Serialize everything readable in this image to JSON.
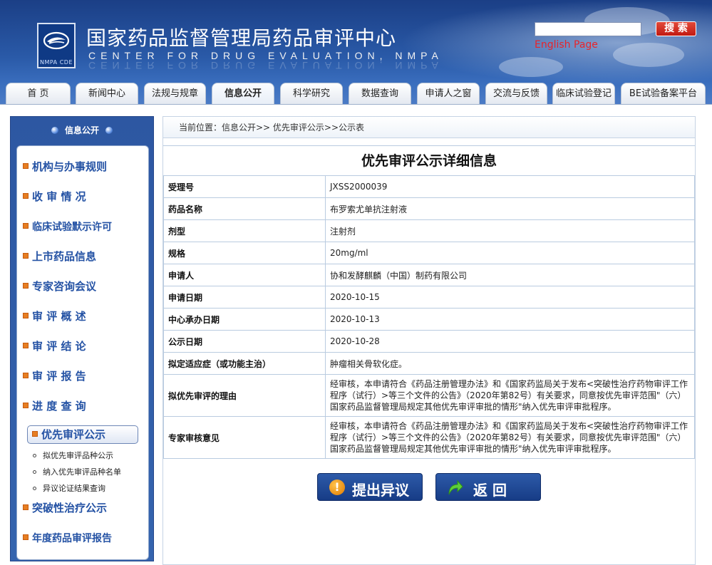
{
  "header": {
    "title": "国家药品监督管理局药品审评中心",
    "subtitle": "CENTER FOR DRUG EVALUATION, NMPA",
    "logo_text": "NMPA CDE",
    "search_placeholder": "",
    "search_button": "搜 索",
    "english_link": "English Page"
  },
  "nav": {
    "tabs": [
      "首 页",
      "新闻中心",
      "法规与规章",
      "信息公开",
      "科学研究",
      "数据查询",
      "申请人之窗",
      "交流与反馈",
      "临床试验登记",
      "BE试验备案平台"
    ],
    "active": "信息公开"
  },
  "sidebar": {
    "title": "信息公开",
    "items": [
      "机构与办事规则",
      "收 审 情 况",
      "临床试验默示许可",
      "上市药品信息",
      "专家咨询会议",
      "审 评 概 述",
      "审 评 结 论",
      "审 评 报 告",
      "进 度 查 询",
      "优先审评公示"
    ],
    "subitems": [
      "拟优先审评品种公示",
      "纳入优先审评品种名单",
      "异议论证结果查询"
    ],
    "items_after": [
      "突破性治疗公示",
      "年度药品审评报告"
    ]
  },
  "content": {
    "breadcrumb": "当前位置：信息公开>> 优先审评公示>>公示表",
    "title": "优先审评公示详细信息",
    "rows": [
      {
        "label": "受理号",
        "value": "JXSS2000039"
      },
      {
        "label": "药品名称",
        "value": "布罗索尤单抗注射液"
      },
      {
        "label": "剂型",
        "value": "注射剂"
      },
      {
        "label": "规格",
        "value": "20mg/ml"
      },
      {
        "label": "申请人",
        "value": "协和发酵麒麟（中国）制药有限公司"
      },
      {
        "label": "申请日期",
        "value": "2020-10-15"
      },
      {
        "label": "中心承办日期",
        "value": "2020-10-13"
      },
      {
        "label": "公示日期",
        "value": "2020-10-28"
      },
      {
        "label": "拟定适应症（或功能主治）",
        "value": "肿瘤相关骨软化症。"
      },
      {
        "label": "拟优先审评的理由",
        "value": "经审核，本申请符合《药品注册管理办法》和《国家药监局关于发布<突破性治疗药物审评工作程序（试行）>等三个文件的公告》（2020年第82号）有关要求，同意按优先审评范围\"（六）国家药品监督管理局规定其他优先审评审批的情形\"纳入优先审评审批程序。"
      },
      {
        "label": "专家审核意见",
        "value": "经审核，本申请符合《药品注册管理办法》和《国家药监局关于发布<突破性治疗药物审评工作程序（试行）>等三个文件的公告》（2020年第82号）有关要求，同意按优先审评范围\"（六）国家药品监督管理局规定其他优先审评审批的情形\"纳入优先审评审批程序。"
      }
    ],
    "objection_button": "提出异议",
    "return_button": "返 回"
  },
  "colors": {
    "header_blue": "#2a5aa8",
    "search_red": "#c11a12",
    "english_red": "#e8242a",
    "sidebar_blue": "#3564ae",
    "link_blue": "#2452a4",
    "bullet_orange": "#e67e22",
    "button_blue": "#173c86"
  },
  "icons": {
    "logo": "nmpa-logo",
    "sidebar_bullet": "orange-square-bullet",
    "objection": "exclamation-circle-icon",
    "return": "green-return-arrow-icon"
  }
}
